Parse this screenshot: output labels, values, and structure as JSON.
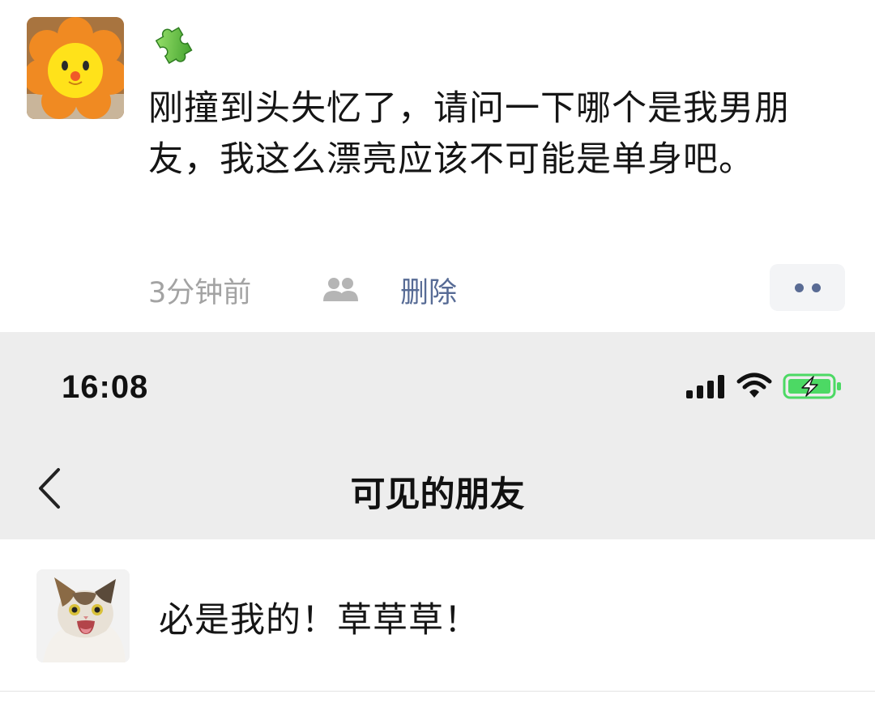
{
  "post": {
    "text": "刚撞到头失忆了，请问一下哪个是我男朋友，我这么漂亮应该不可能是单身吧。",
    "time": "3分钟前",
    "delete_label": "删除",
    "icons": {
      "avatar": "flower-doll-avatar",
      "sticker": "puzzle-piece-icon",
      "visibility": "people-icon",
      "more": "more-dots-icon"
    }
  },
  "status_bar": {
    "time": "16:08",
    "icons": [
      "signal-icon",
      "wifi-icon",
      "battery-charging-icon"
    ]
  },
  "nav": {
    "title": "可见的朋友",
    "back_icon": "chevron-left-icon"
  },
  "friends": [
    {
      "name": "必是我的！草草草！",
      "avatar": "cat-avatar"
    }
  ],
  "colors": {
    "link": "#576b95",
    "meta_gray": "#a3a3a3",
    "header_bg": "#ededed",
    "battery_green": "#4cd964"
  }
}
